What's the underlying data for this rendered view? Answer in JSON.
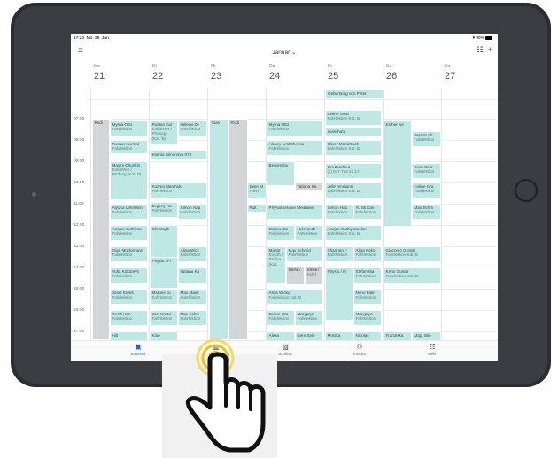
{
  "status": {
    "time": "17:23",
    "date": "Mo. 28. Jan.",
    "wifi": "▼",
    "battery": "90%"
  },
  "toolbar": {
    "title": "Januar ⌄",
    "menu_icon": "hamburger-icon",
    "grid_icon": "grid-icon",
    "add_icon": "plus-icon"
  },
  "days": [
    {
      "name": "Mo",
      "num": "21"
    },
    {
      "name": "Di",
      "num": "22"
    },
    {
      "name": "Mi",
      "num": "23"
    },
    {
      "name": "Do",
      "num": "24"
    },
    {
      "name": "Fr",
      "num": "25"
    },
    {
      "name": "Sa",
      "num": "26"
    },
    {
      "name": "So",
      "num": "27"
    }
  ],
  "allday": "Geburtstag von Peter I",
  "hours": [
    "07:00",
    "08:00",
    "09:00",
    "10:00",
    "11:00",
    "12:00",
    "13:00",
    "14:00",
    "15:00",
    "16:00",
    "17:00"
  ],
  "events": {
    "rudi_mon": "Rudi",
    "mon1": {
      "t": "Myrna Otto",
      "s": "Fahrlektion"
    },
    "mon2": {
      "t": "Rustan Karmal",
      "s": "Fahrlektion"
    },
    "mon3": {
      "t": "Maxim Chunkin",
      "s": "Einfahren / Prüfung (Kat. B)"
    },
    "mon4": {
      "t": "Alyona Lehmann",
      "s": "Fahrlektion"
    },
    "mon5": {
      "t": "Anojan Sathiyas",
      "s": "Fahrlektion"
    },
    "mon6": {
      "t": "Gian Mühlemann",
      "s": "Fahrlektion"
    },
    "mon7": {
      "t": "Yulia Kokorevs",
      "s": "Fahrlektion"
    },
    "mon8": {
      "t": "Josef Krebs",
      "s": "Fahrlektion"
    },
    "mon9": {
      "t": "Yu Mi Kan",
      "s": "Fahrlektion"
    },
    "mon10": {
      "t": "Hilt",
      "s": ""
    },
    "tue1": {
      "t": "Rustan Kar",
      "s": "Einfahren / Prüfung (Kat. B)"
    },
    "tue2": {
      "t": "Helena Ze",
      "s": "Fahrlektion"
    },
    "tue3": {
      "t": "Ksenia Simonova 078",
      "s": ""
    },
    "tue4": {
      "t": "Kuzma Marchuk",
      "s": "Fahrlektion"
    },
    "tue5": {
      "t": "Evgeny Ko",
      "s": "Fahrlektion"
    },
    "tue6": {
      "t": "Simon Hap",
      "s": "Fahrlektion"
    },
    "tue7": {
      "t": "Christoph",
      "s": ""
    },
    "tue8": {
      "t": "Alina Wick",
      "s": "Fahrlektion"
    },
    "tue9": {
      "t": "Physio / Fi",
      "s": ""
    },
    "tue10": {
      "t": "Tatiana Ka",
      "s": ""
    },
    "tue11": {
      "t": "Martine Gi",
      "s": "Fahrlektion"
    },
    "tue12": {
      "t": "Max Maek",
      "s": "Fahrlektion"
    },
    "tue13": {
      "t": "Joel Krebs",
      "s": "Fahrlektion"
    },
    "tue14": {
      "t": "Max Schm",
      "s": "Fahrlektion"
    },
    "tue15": {
      "t": "Kine",
      "s": ""
    },
    "wed_gian": "Gian",
    "wed_rudi": "Rudi",
    "thu1": {
      "t": "Myrna Otto",
      "s": "Fahrlektion"
    },
    "thu2": {
      "t": "Alexey Leshchenko",
      "s": "Fahrlektion"
    },
    "thu3": {
      "t": "Besprechu",
      "s": ""
    },
    "thu4": {
      "t": "Sven M",
      "s": "Fahrl"
    },
    "thu5": {
      "t": "Tatiana Ka",
      "s": ""
    },
    "thu6": {
      "t": "Pult",
      "s": ""
    },
    "thu7": {
      "t": "Physiotherapie Medbase",
      "s": ""
    },
    "thu8": {
      "t": "Carina Ste",
      "s": "Fahrlektion"
    },
    "thu9": {
      "t": "Helena Ze",
      "s": "Fahrlektion"
    },
    "thu10": {
      "t": "Martin",
      "s": "Einfah / Prüfun (Kat."
    },
    "thu11": {
      "t": "Max Schmid",
      "s": "Fahrlektion"
    },
    "thu12": {
      "t": "Stefan",
      "s": ""
    },
    "thu13": {
      "t": "Stefan",
      "s": "Fahrl"
    },
    "thu14": {
      "t": "Alina Wicky",
      "s": "Fahrlektion Kat. B"
    },
    "thu15": {
      "t": "Celine Gra",
      "s": "Fahrlektion"
    },
    "thu16": {
      "t": "Maryprya",
      "s": "Fahrlektion"
    },
    "thu17": {
      "t": "Alexa",
      "s": ""
    },
    "thu18": {
      "t": "Bern Sele",
      "s": ""
    },
    "fri1": {
      "t": "Celine Stutz",
      "s": "Fahrlektion Kat. B"
    },
    "fri2": {
      "t": "Zwischutz",
      "s": ""
    },
    "fri3": {
      "t": "Oliver Mühlebach",
      "s": "Fahrlektion Kat. B"
    },
    "fri4": {
      "t": "Urs Zwahlen",
      "s": "(c) 047 720 42 17"
    },
    "fri5": {
      "t": "Jelle Ammann",
      "s": "Fahrlektion Kat. B"
    },
    "fri6": {
      "t": "Simon Hau",
      "s": "Fahrlektion"
    },
    "fri7": {
      "t": "Yu Mi Kan",
      "s": "Fahrlektion"
    },
    "fri8": {
      "t": "Anojan Sathiyaseelan",
      "s": "Fahrlektion Kat. B"
    },
    "fri9": {
      "t": "Shannon F",
      "s": "Fahrlektion"
    },
    "fri10": {
      "t": "Alina Koko",
      "s": "Fahrlektion"
    },
    "fri11": {
      "t": "Physio / Fi",
      "s": ""
    },
    "fri12": {
      "t": "Stefan Ma",
      "s": "Fahrlektion"
    },
    "fri13": {
      "t": "Nurul Fatir",
      "s": "Fahrlektion"
    },
    "fri14": {
      "t": "Maryprya",
      "s": "Fahrlektion"
    },
    "fri15": {
      "t": "Monika",
      "s": ""
    },
    "fri16": {
      "t": "Nicolas",
      "s": ""
    },
    "sat1": {
      "t": "Esther we",
      "s": ""
    },
    "sat2": {
      "t": "Jasmin Vil",
      "s": "Fahrlektion"
    },
    "sat3": {
      "t": "Sven Schr",
      "s": "Fahrlektion"
    },
    "sat4": {
      "t": "Celine Gra",
      "s": "Fahrlektion"
    },
    "sat5": {
      "t": "Max Schm",
      "s": "Fahrlektion"
    },
    "sat6": {
      "t": "Giacomo Grassi",
      "s": "Fahrlektion Kat. B"
    },
    "sat7": {
      "t": "Kerin Gunter",
      "s": "Fahrlektion Kat. B"
    },
    "sat8": {
      "t": "Franziska",
      "s": ""
    },
    "sat9": {
      "t": "Maja Wie",
      "s": ""
    }
  },
  "tabs": [
    {
      "label": "Kalender",
      "icon": "calendar-icon",
      "glyph": "▣"
    },
    {
      "label": "Tagebuch",
      "icon": "book-icon",
      "glyph": "▥"
    },
    {
      "label": "Booking",
      "icon": "booking-icon",
      "glyph": "▨"
    },
    {
      "label": "Kunden",
      "icon": "people-icon",
      "glyph": "⚇"
    },
    {
      "label": "Mehr",
      "icon": "more-icon",
      "glyph": "☷"
    }
  ],
  "colors": {
    "accent": "#2066c9",
    "event": "#bfe8e4",
    "event_gray": "#d2d6d8",
    "tap": "#f2c400"
  }
}
